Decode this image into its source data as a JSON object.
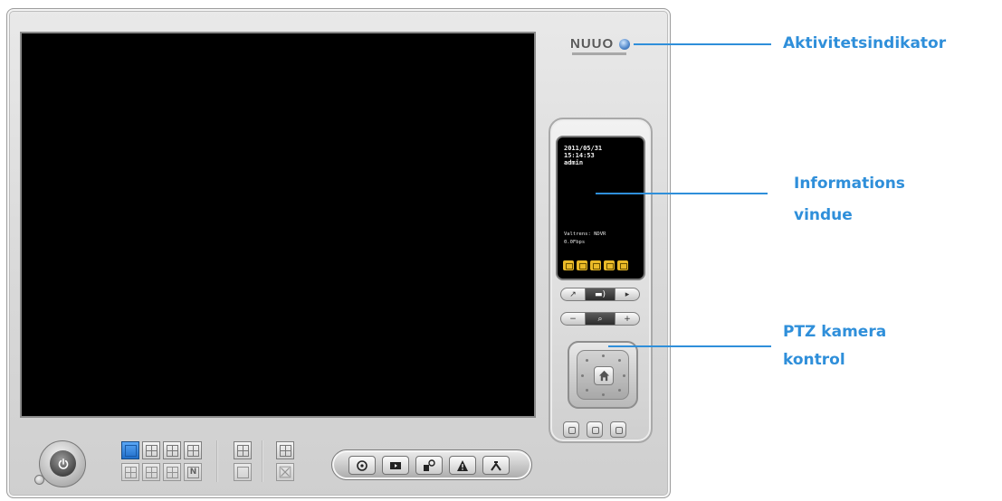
{
  "window": {
    "logo_text": "NUUO"
  },
  "info_panel": {
    "date": "2011/05/31",
    "time": "15:14:53",
    "user": "admin",
    "server_line": "Valtrens: NDVR",
    "fps_line": "0.0Fbps",
    "status_icons": [
      "record-status-icon",
      "playback-status-icon",
      "lock-status-icon",
      "network-status-icon",
      "alarm-status-icon"
    ]
  },
  "ptz": {
    "row1": {
      "left": "↗",
      "mid": "▬)",
      "right": "▸"
    },
    "row2": {
      "left": "−",
      "mid": "⌕",
      "right": "+"
    },
    "presets": [
      "preset-1",
      "preset-2",
      "preset-3"
    ]
  },
  "toolbar": {
    "layouts_top": [
      "1x1",
      "2x2",
      "1+5",
      "3x3"
    ],
    "layouts_bottom": [
      "4x4",
      "5x5",
      "6x6",
      "N"
    ],
    "letter_n": "N",
    "func_buttons": [
      {
        "name": "schedule-button",
        "icon": "clock-icon"
      },
      {
        "name": "playback-button",
        "icon": "playback-icon"
      },
      {
        "name": "camera-config-button",
        "icon": "camera-icon"
      },
      {
        "name": "alarm-button",
        "icon": "warning-icon"
      },
      {
        "name": "tools-button",
        "icon": "tools-icon"
      }
    ]
  },
  "callouts": {
    "activity": "Aktivitetsindikator",
    "info_window_1": "Informations",
    "info_window_2": "vindue",
    "ptz_1": "PTZ kamera",
    "ptz_2": "kontrol"
  },
  "colors": {
    "callout": "#2f8fda",
    "active_layout": "#1f6dc9",
    "status_icon": "#e9b928"
  }
}
